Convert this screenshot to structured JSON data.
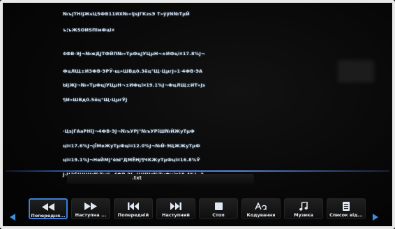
{
  "document": {
    "lines": [
      "№ъјТНіјЖєЦ5ФВ11ИХ№«іјsјГКзsЭ  Т»ўўN№ТµЙ",
      "ъ¦ъЖSOИSПiмФці¤",
      "4ФВ·ЭJ¬№жДJТФЙП№«ТµФцјУЦµН¬±ИФці¤17.8%J¬",
      "ФцЛЩ±И3ФВ·ЭРЎ·щ»ШВд0.3ёц°Щ·ЦµгJ»1·4ФВ·ЭА",
      "ЫјЖJ¬№«ТµФцјУЦµН¬±ИФці¤19.1%J¬ФцЛЩ±ИТ»јs",
      "¶И»ШВд0.5ёц°Щ·ЦµгЎJ",
      "·ЦsјГАаРНїJ¬4ФВ·ЭJ¬№ъУРј°№ъУРїШ№ЙЖуТµФ",
      "ці¤17.6%J¬јЇМеЖуТµФці¤12.0%J¬№Й·ЭЦЖЖуТµФ",
      "ці¤19.1%J¬НвЙМј°ёЫ°ДМЁНј¶ЧКЖуТµФці¤16.8%Ў",
      "J·Ц3бЦШНг№ТµІJ¬4ФВ·ЭJ¬ЦШНг№ТµФці¤19.4%J¬3"
    ],
    "filename": ".txt"
  },
  "toolbar": {
    "buttons": [
      {
        "label": "Попередня...",
        "icon": "rewind-icon"
      },
      {
        "label": "Наступна ...",
        "icon": "fast-forward-icon"
      },
      {
        "label": "Попередній",
        "icon": "skip-previous-icon"
      },
      {
        "label": "Наступний",
        "icon": "skip-next-icon"
      },
      {
        "label": "Стоп",
        "icon": "stop-icon"
      },
      {
        "label": "Кодування",
        "icon": "encoding-icon"
      },
      {
        "label": "Музика",
        "icon": "music-note-icon"
      },
      {
        "label": "Список від...",
        "icon": "list-document-icon"
      }
    ]
  },
  "colors": {
    "accent": "#3d7ed8",
    "text": "#cfe0f0",
    "background": "#050505"
  }
}
